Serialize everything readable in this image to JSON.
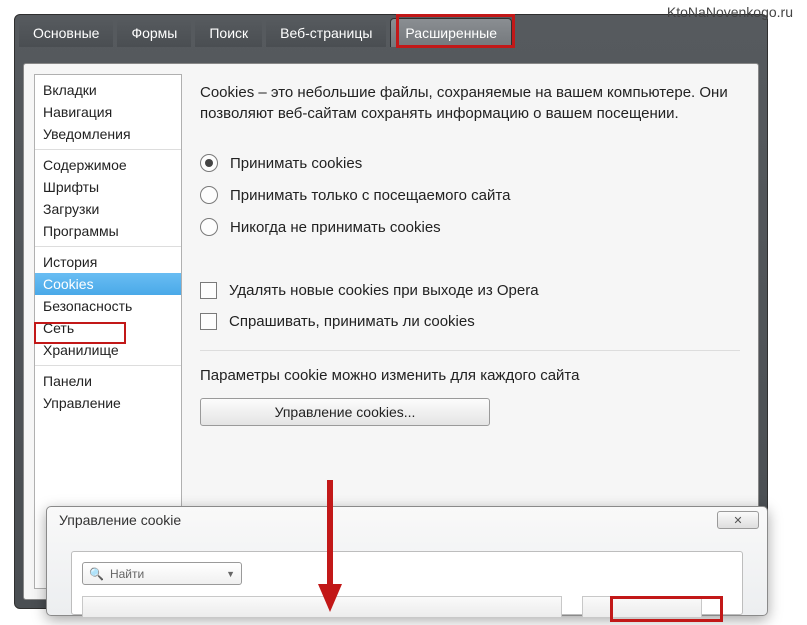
{
  "watermark": "KtoNaNovenkogo.ru",
  "tabs": [
    "Основные",
    "Формы",
    "Поиск",
    "Веб-страницы",
    "Расширенные"
  ],
  "active_tab_index": 4,
  "sidebar_groups": [
    [
      "Вкладки",
      "Навигация",
      "Уведомления"
    ],
    [
      "Содержимое",
      "Шрифты",
      "Загрузки",
      "Программы"
    ],
    [
      "История",
      "Cookies",
      "Безопасность",
      "Сеть",
      "Хранилище"
    ],
    [
      "Панели",
      "Управление"
    ]
  ],
  "sidebar_selected": "Cookies",
  "description": "Cookies – это небольшие файлы, сохраняемые на вашем компьютере. Они позволяют веб-сайтам сохранять информацию о вашем посещении.",
  "radios": [
    "Принимать cookies",
    "Принимать только с посещаемого сайта",
    "Никогда не принимать cookies"
  ],
  "radio_selected_index": 0,
  "checks": [
    "Удалять новые cookies при выходе из Opera",
    "Спрашивать, принимать ли cookies"
  ],
  "param_label": "Параметры cookie можно изменить для каждого сайта",
  "manage_btn": "Управление cookies...",
  "popup_title": "Управление cookie",
  "search_placeholder": "Найти"
}
